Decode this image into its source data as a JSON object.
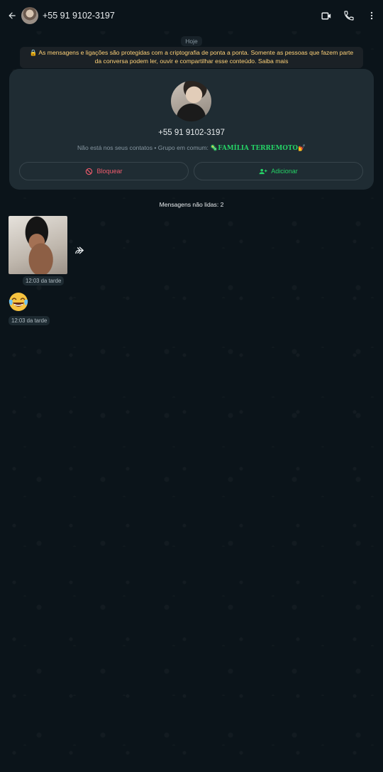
{
  "header": {
    "contact_name": "+55 91 9102-3197",
    "icons": [
      "back-arrow-icon",
      "video-call-icon",
      "phone-icon",
      "more-vert-icon"
    ]
  },
  "date_chip": "Hoje",
  "encryption_notice": "🔒 As mensagens e ligações são protegidas com a criptografia de ponta a ponta. Somente as pessoas que fazem parte da conversa podem ler, ouvir e compartilhar esse conteúdo. Saiba mais",
  "profile_card": {
    "phone": "+55 91 9102-3197",
    "not_in_contacts": "Não está nos seus contatos • Grupo em comum:",
    "group_name": "🦠FAMÍLIA TERREMOTO💅",
    "block_label": "Bloquear",
    "add_label": "Adicionar"
  },
  "unread_label": "Mensagens não lidas: 2",
  "messages": [
    {
      "type": "image",
      "time": "12:03 da tarde"
    },
    {
      "type": "emoji",
      "content": "😂",
      "time": "12:03 da tarde"
    }
  ],
  "colors": {
    "background": "#0b141a",
    "card": "#1f2c33",
    "accent_green": "#25d366",
    "danger_red": "#f15c6d",
    "notice_yellow": "#ffd279"
  }
}
